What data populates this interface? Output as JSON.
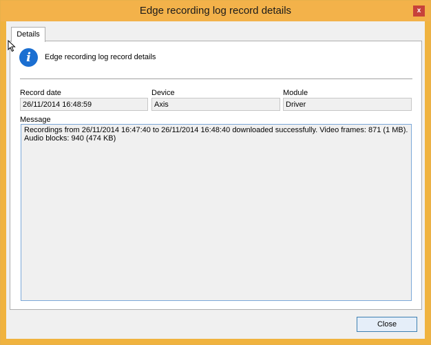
{
  "window": {
    "title": "Edge recording log record details",
    "close_glyph": "x"
  },
  "tabs": [
    {
      "label": "Details"
    }
  ],
  "header": {
    "icon": "info-icon",
    "text": "Edge recording log record details"
  },
  "fields": {
    "record_date": {
      "label": "Record date",
      "value": "26/11/2014 16:48:59"
    },
    "device": {
      "label": "Device",
      "value": "Axis"
    },
    "module": {
      "label": "Module",
      "value": "Driver"
    },
    "message": {
      "label": "Message",
      "value": "Recordings from 26/11/2014 16:47:40 to 26/11/2014 16:48:40 downloaded successfully. Video frames: 871 (1 MB).\nAudio blocks: 940 (474 KB)"
    }
  },
  "buttons": {
    "close_label": "Close"
  },
  "colors": {
    "titlebar": "#f3b24a",
    "info_icon": "#1b6fd1",
    "close_button_border": "#3c7fb1"
  }
}
